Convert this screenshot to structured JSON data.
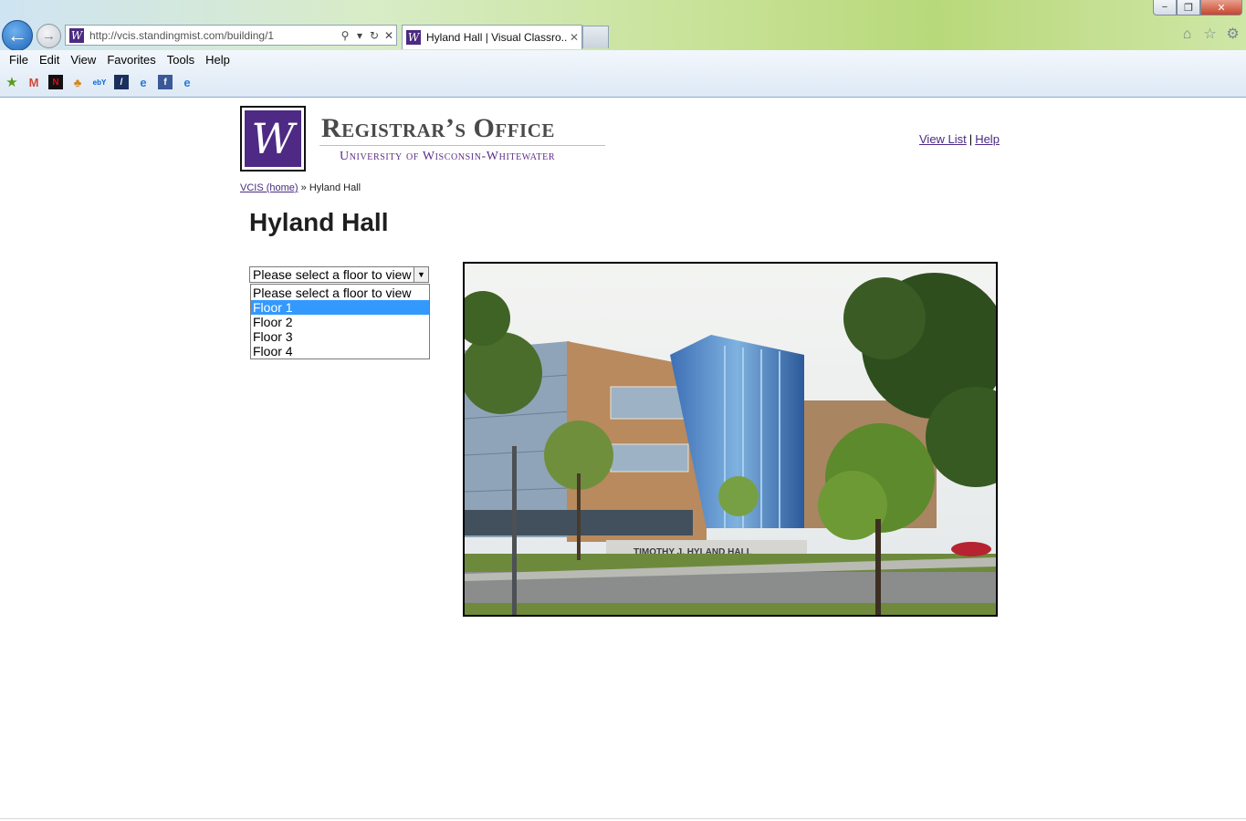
{
  "browser": {
    "address": {
      "url": "http://vcis.standingmist.com/building/1"
    },
    "tab": {
      "title": "Hyland Hall | Visual Classro..."
    },
    "menu": [
      "File",
      "Edit",
      "View",
      "Favorites",
      "Tools",
      "Help"
    ],
    "window_controls": {
      "minimize": "−",
      "maximize": "❐",
      "close": "✕"
    }
  },
  "header": {
    "office_title": "Registrar’s Office",
    "office_subtitle": "University of Wisconsin-Whitewater",
    "logo_letter": "W",
    "links": {
      "view_list": "View List",
      "separator": "|",
      "help": "Help"
    }
  },
  "breadcrumb": {
    "home": "VCIS (home)",
    "separator": "»",
    "current": "Hyland Hall"
  },
  "page": {
    "title": "Hyland Hall"
  },
  "floor_select": {
    "selected": "Please select a floor to view",
    "options": [
      "Please select a floor to view",
      "Floor 1",
      "Floor 2",
      "Floor 3",
      "Floor 4"
    ],
    "highlighted": "Floor 1"
  },
  "photo": {
    "sign_text": "TIMOTHY J. HYLAND HALL"
  },
  "colors": {
    "accent_purple": "#4e2a84",
    "link": "#4b2a82",
    "highlight": "#3399ff"
  }
}
